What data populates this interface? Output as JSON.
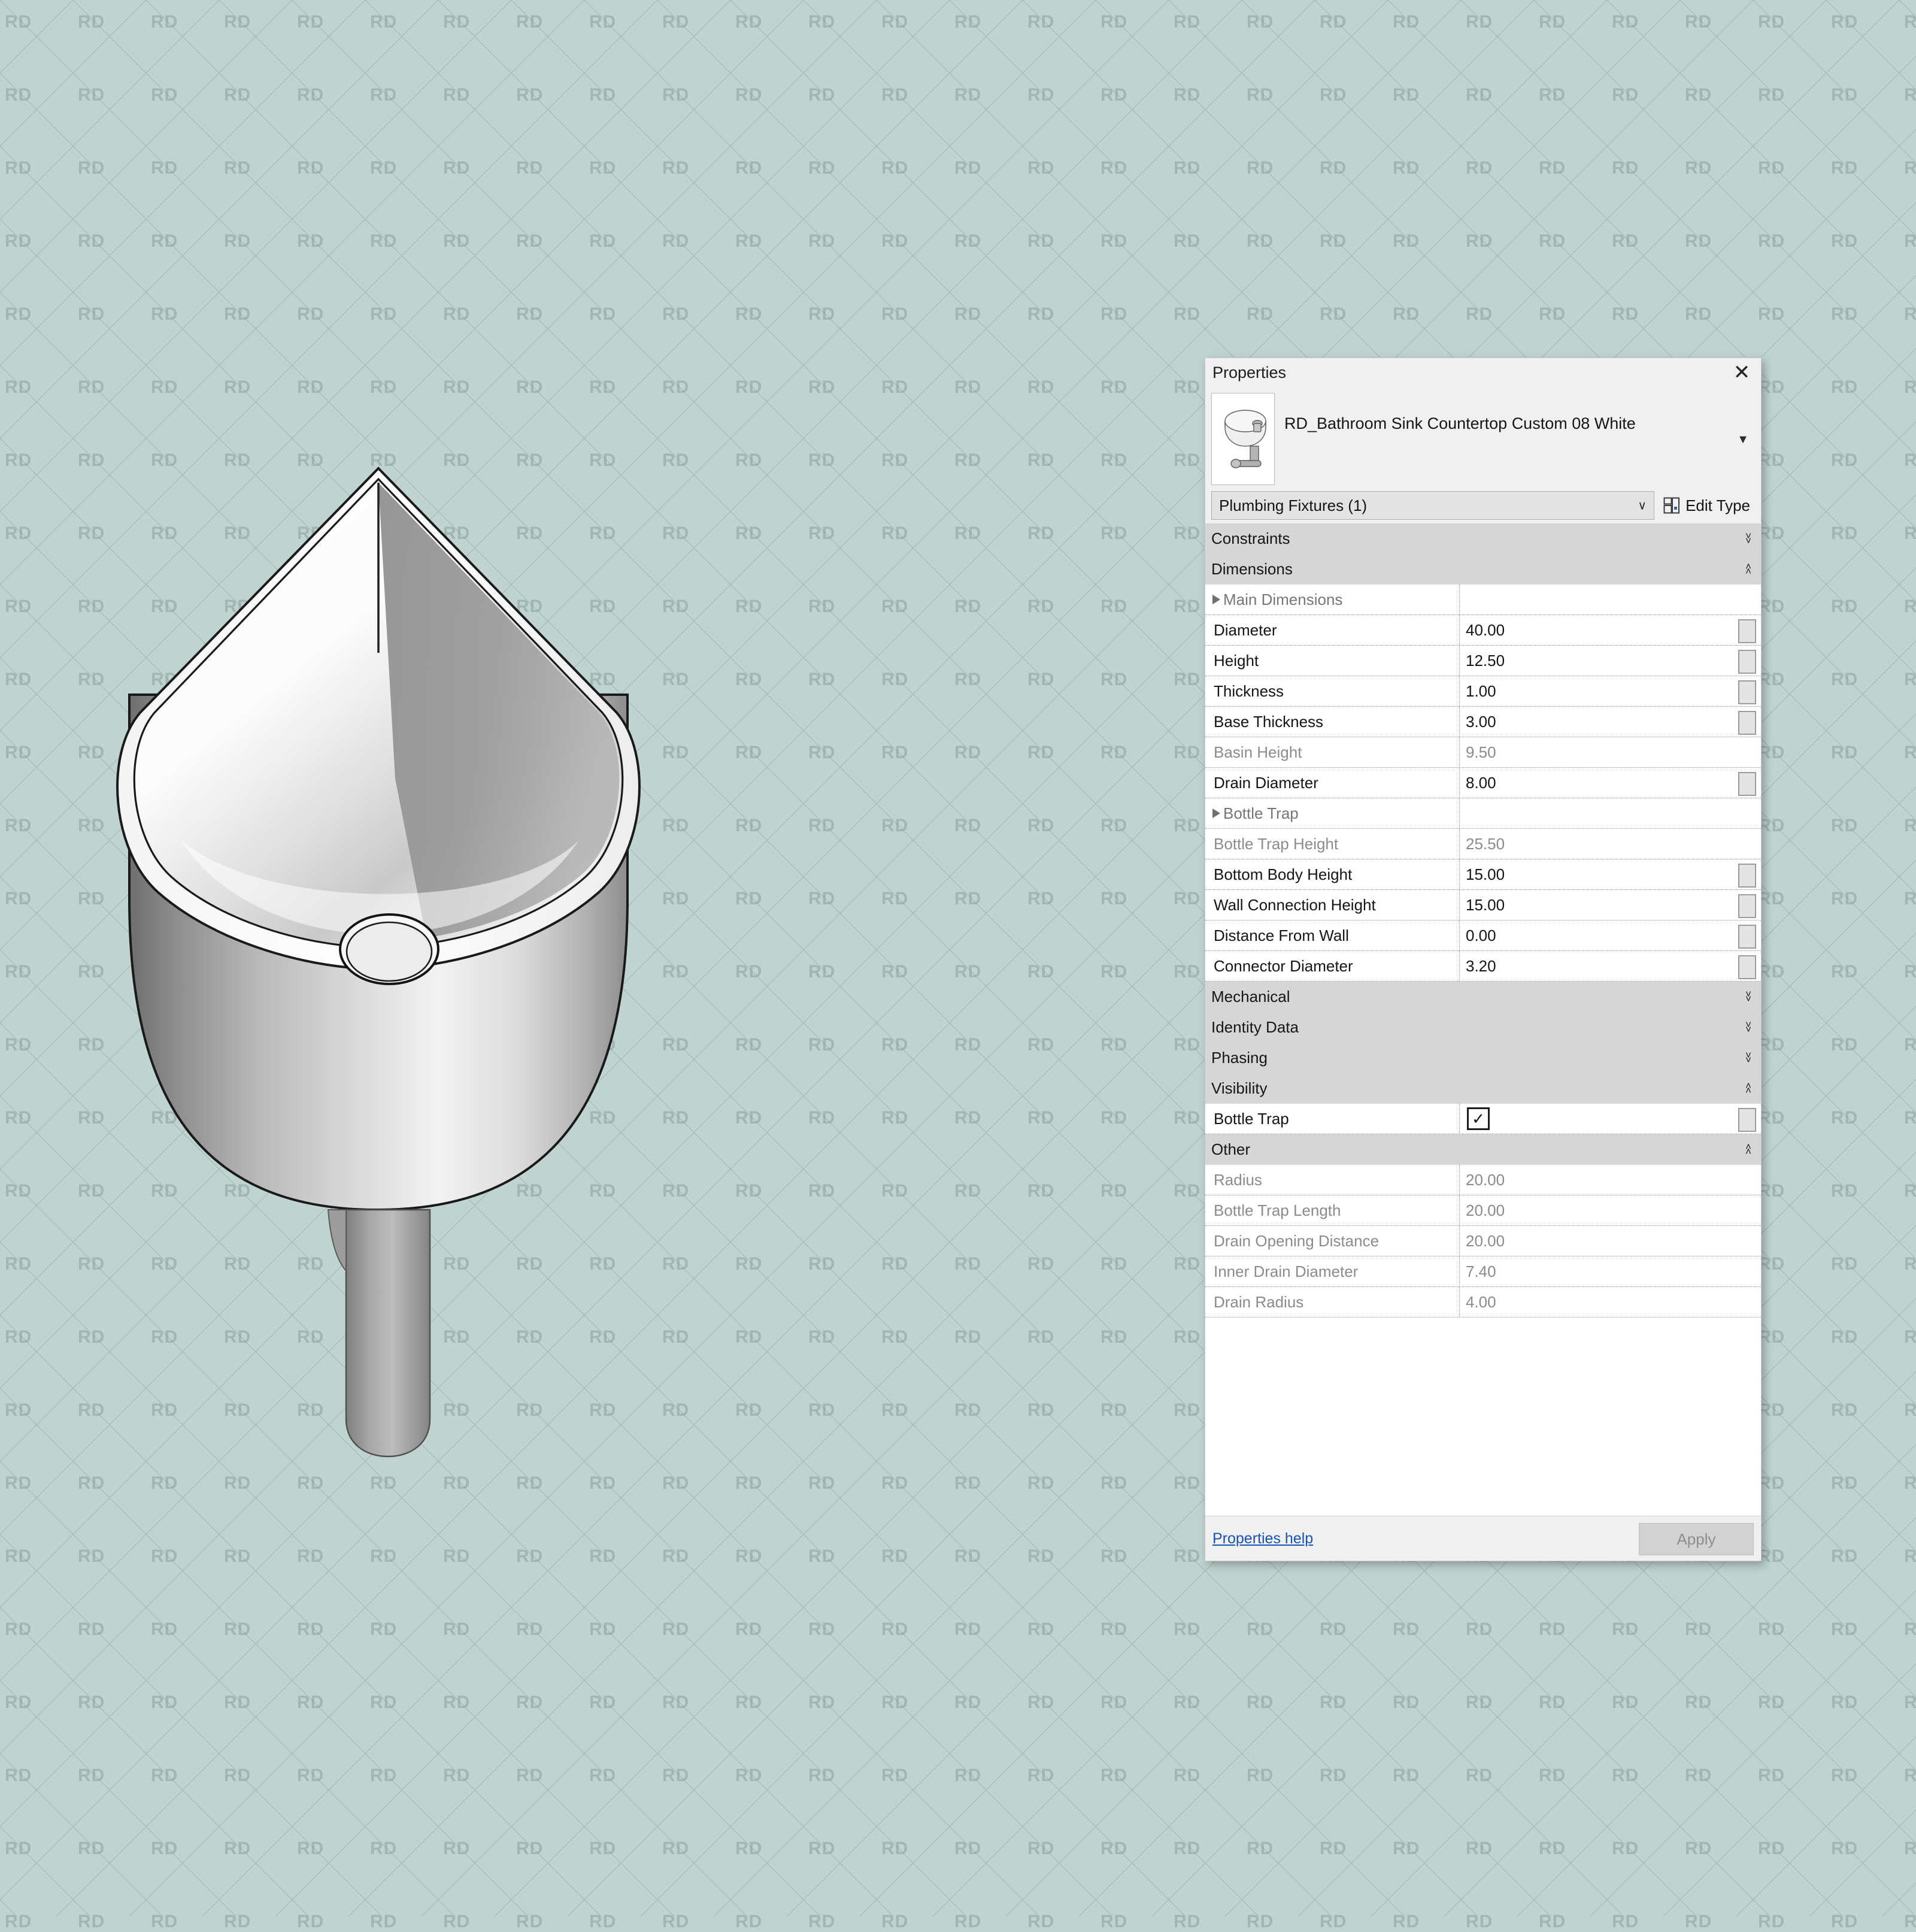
{
  "background": {
    "color": "#bfd3d1",
    "watermark_text": "RD",
    "watermark_color": "#78918f"
  },
  "model": {
    "description": "Isometric shaded 3D view of a teardrop-shaped white countertop bathroom sink with circular drain and cylindrical bottle trap pipe below",
    "basin_color": "#ffffff",
    "shadow_color": "#8a8a8a",
    "outline_color": "#1a1a1a"
  },
  "panel": {
    "title": "Properties",
    "close_label": "✕",
    "type_name": "RD_Bathroom Sink Countertop Custom 08 White",
    "type_dropdown_label": "▼",
    "category_selector": {
      "value": "Plumbing Fixtures (1)",
      "chevron": "∨"
    },
    "edit_type_label": "Edit Type",
    "footer": {
      "help_label": "Properties help",
      "apply_label": "Apply"
    },
    "collapse_glyph": "˄",
    "expand_glyph": "˅",
    "groups": [
      {
        "name": "Constraints",
        "state": "collapsed",
        "rows": []
      },
      {
        "name": "Dimensions",
        "state": "expanded",
        "rows": [
          {
            "label": "Main Dimensions",
            "value": "",
            "kind": "group-header",
            "enabled": false,
            "assoc": false
          },
          {
            "label": "Diameter",
            "value": "40.00",
            "kind": "value",
            "enabled": true,
            "assoc": true
          },
          {
            "label": "Height",
            "value": "12.50",
            "kind": "value",
            "enabled": true,
            "assoc": true
          },
          {
            "label": "Thickness",
            "value": "1.00",
            "kind": "value",
            "enabled": true,
            "assoc": true
          },
          {
            "label": "Base Thickness",
            "value": "3.00",
            "kind": "value",
            "enabled": true,
            "assoc": true
          },
          {
            "label": "Basin Height",
            "value": "9.50",
            "kind": "value",
            "enabled": false,
            "assoc": false
          },
          {
            "label": "Drain Diameter",
            "value": "8.00",
            "kind": "value",
            "enabled": true,
            "assoc": true
          },
          {
            "label": "Bottle Trap",
            "value": "",
            "kind": "group-header",
            "enabled": false,
            "assoc": false
          },
          {
            "label": "Bottle Trap Height",
            "value": "25.50",
            "kind": "value",
            "enabled": false,
            "assoc": false
          },
          {
            "label": "Bottom Body Height",
            "value": "15.00",
            "kind": "value",
            "enabled": true,
            "assoc": true
          },
          {
            "label": "Wall Connection Height",
            "value": "15.00",
            "kind": "value",
            "enabled": true,
            "assoc": true
          },
          {
            "label": "Distance From Wall",
            "value": "0.00",
            "kind": "value",
            "enabled": true,
            "assoc": true
          },
          {
            "label": "Connector Diameter",
            "value": "3.20",
            "kind": "value",
            "enabled": true,
            "assoc": true
          }
        ]
      },
      {
        "name": "Mechanical",
        "state": "collapsed",
        "rows": []
      },
      {
        "name": "Identity Data",
        "state": "collapsed",
        "rows": []
      },
      {
        "name": "Phasing",
        "state": "collapsed",
        "rows": []
      },
      {
        "name": "Visibility",
        "state": "expanded",
        "rows": [
          {
            "label": "Bottle Trap",
            "value": "",
            "kind": "checkbox",
            "checked": true,
            "enabled": true,
            "assoc": true
          }
        ]
      },
      {
        "name": "Other",
        "state": "expanded",
        "rows": [
          {
            "label": "Radius",
            "value": "20.00",
            "kind": "value",
            "enabled": false,
            "assoc": false
          },
          {
            "label": "Bottle Trap Length",
            "value": "20.00",
            "kind": "value",
            "enabled": false,
            "assoc": false
          },
          {
            "label": "Drain Opening Distance",
            "value": "20.00",
            "kind": "value",
            "enabled": false,
            "assoc": false
          },
          {
            "label": "Inner Drain Diameter",
            "value": "7.40",
            "kind": "value",
            "enabled": false,
            "assoc": false
          },
          {
            "label": "Drain Radius",
            "value": "4.00",
            "kind": "value",
            "enabled": false,
            "assoc": false
          }
        ]
      }
    ]
  }
}
